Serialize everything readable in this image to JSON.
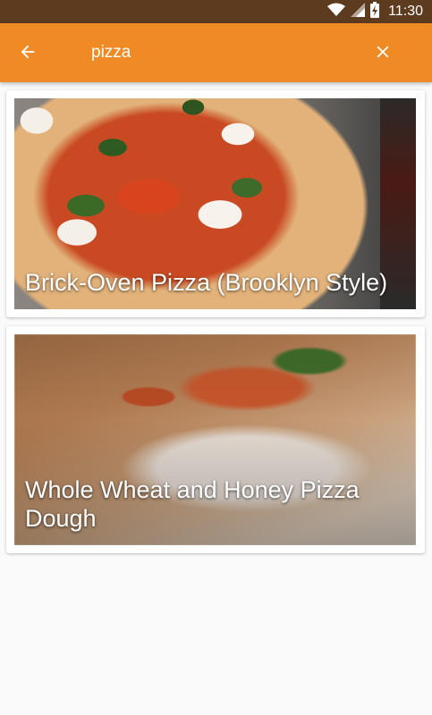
{
  "status_bar": {
    "time": "11:30",
    "icons": [
      "wifi-icon",
      "signal-icon",
      "battery-charging-icon"
    ]
  },
  "toolbar": {
    "back_icon": "arrow-left-icon",
    "search_value": "pizza",
    "clear_icon": "close-icon",
    "background_color": "#f08a24"
  },
  "results": [
    {
      "title": "Brick-Oven Pizza (Brooklyn Style)"
    },
    {
      "title": "Whole Wheat and Honey Pizza Dough"
    }
  ]
}
